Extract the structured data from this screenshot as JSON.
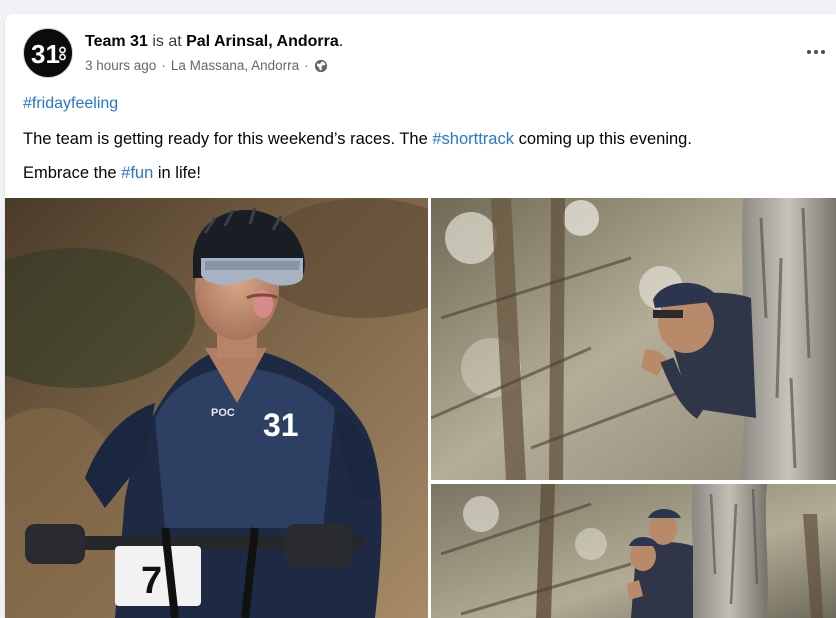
{
  "post": {
    "author": "Team 31",
    "action_text": "is at",
    "location": "Pal Arinsal, Andorra",
    "period": ".",
    "time": "3 hours ago",
    "place": "La Massana, Andorra",
    "separator": "·",
    "privacy_icon": "globe-icon",
    "menu_icon": "more-options-icon",
    "hashtag": "#fridayfeeling",
    "text_part1": "The team is getting ready for this weekend’s races. The ",
    "tag_shorttrack": "#shorttrack",
    "text_part2": " coming up this evening.",
    "text_part3": "Embrace the ",
    "tag_fun": "#fun",
    "text_part4": " in life!"
  },
  "photos": {
    "rider_jersey_mark": "31",
    "rider_brand": "POC",
    "plate_number": "7"
  },
  "colors": {
    "link": "#2775d1",
    "meta": "#65676b",
    "background": "#f0f2f5"
  }
}
